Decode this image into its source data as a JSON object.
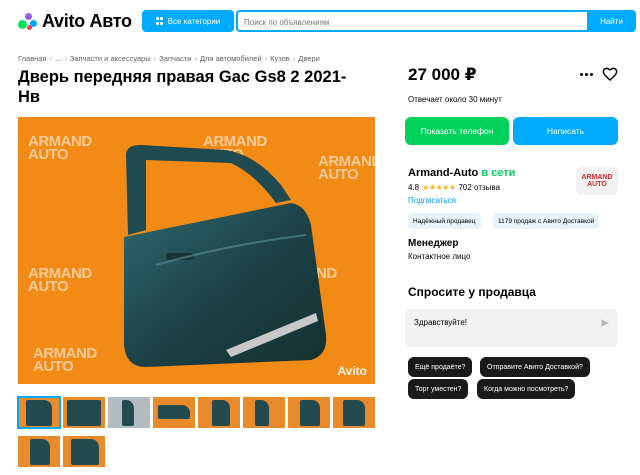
{
  "header": {
    "logo_text": "Avito Авто",
    "categories_label": "Все категории",
    "search_placeholder": "Поиск по объявлениям",
    "search_button": "Найти"
  },
  "breadcrumb": [
    "Главная",
    "...",
    "Запчасти и аксессуары",
    "Запчасти",
    "Для автомобилей",
    "Кузов",
    "Двери"
  ],
  "listing": {
    "title": "Дверь передняя правая Gac Gs8 2 2021-Нв",
    "price": "27 000 ₽",
    "reply_time": "Отвечает около 30 минут",
    "photo_watermark_lines": [
      "ARMAND",
      "AUTO"
    ],
    "photo_site_watermark": "Avito",
    "thumbnail_count": 10
  },
  "actions": {
    "phone_button": "Показать телефон",
    "write_button": "Написать",
    "more_icon": "more-horizontal-icon",
    "favorite_icon": "heart-icon"
  },
  "seller": {
    "name": "Armand-Auto",
    "online": "в сети",
    "rating": "4.8",
    "stars": "★★★★★",
    "reviews": "702 отзыва",
    "subscribe": "Подписаться",
    "logo_lines": [
      "ARMAND",
      "AUTO"
    ],
    "badges": [
      "Надёжный продавец",
      "1179 продаж с Авито Доставкой"
    ],
    "role": "Менеджер",
    "contact": "Контактное лицо"
  },
  "ask": {
    "title": "Спросите у продавца",
    "message_value": "Здравствуйте!",
    "send_icon": "send-icon",
    "chips": [
      "Ещё продаёте?",
      "Отправите Авито Доставкой?",
      "Торг уместен?",
      "Когда можно посмотреть?"
    ]
  },
  "colors": {
    "accent": "#00aaff",
    "green": "#02d15c",
    "photo_bg": "#f28a16",
    "door": "#234a4f"
  }
}
